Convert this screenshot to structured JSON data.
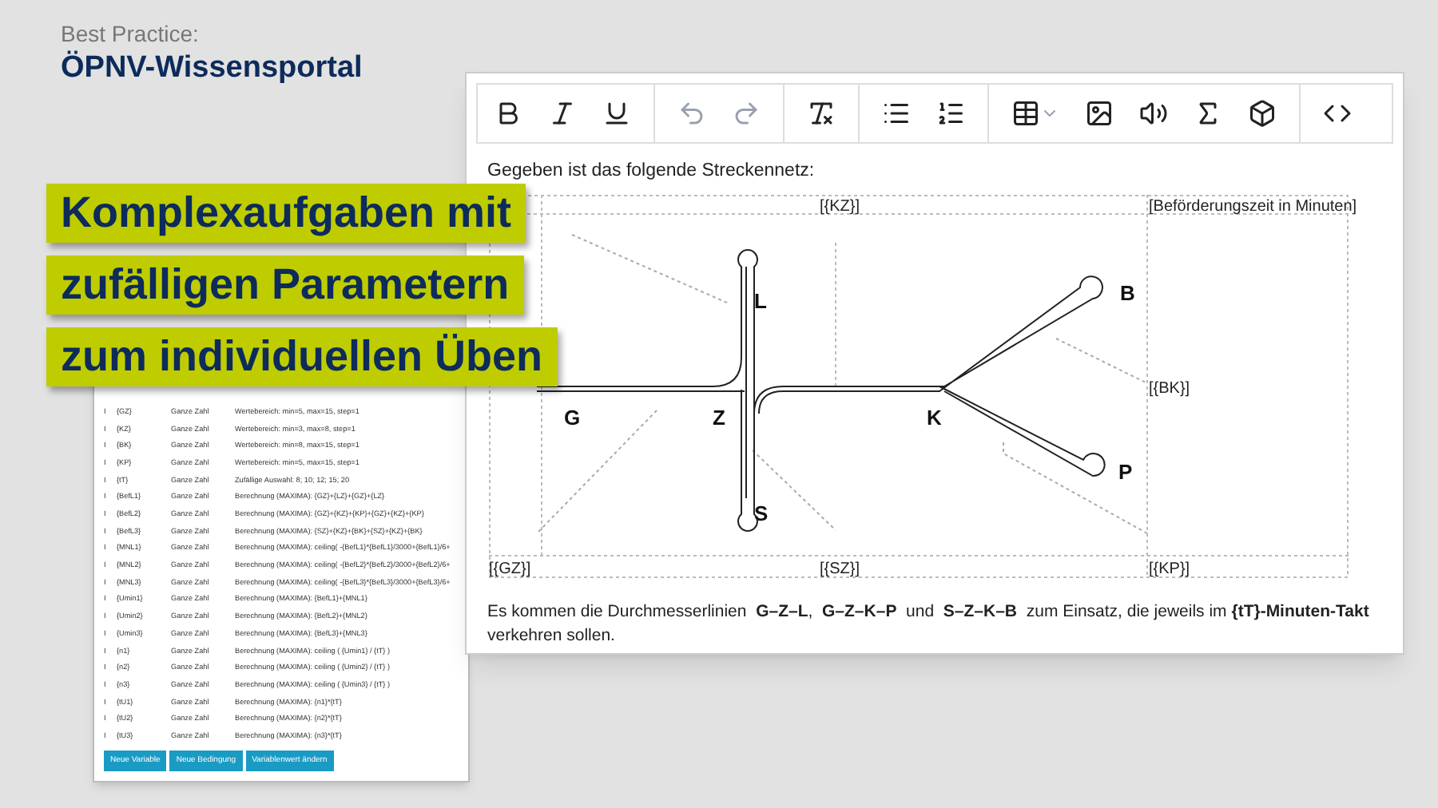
{
  "header": {
    "kicker": "Best Practice:",
    "title": "ÖPNV-Wissensportal"
  },
  "banners": [
    "Komplexaufgaben mit",
    "zufälligen Parametern",
    "zum individuellen Üben"
  ],
  "variables": {
    "rows": [
      {
        "marker": "I",
        "name": "{GZ}",
        "type": "Ganze Zahl",
        "definition": "Wertebereich: min=5, max=15, step=1"
      },
      {
        "marker": "I",
        "name": "{KZ}",
        "type": "Ganze Zahl",
        "definition": "Wertebereich: min=3, max=8, step=1"
      },
      {
        "marker": "I",
        "name": "{BK}",
        "type": "Ganze Zahl",
        "definition": "Wertebereich: min=8, max=15, step=1"
      },
      {
        "marker": "I",
        "name": "{KP}",
        "type": "Ganze Zahl",
        "definition": "Wertebereich: min=5, max=15, step=1"
      },
      {
        "marker": "I",
        "name": "{tT}",
        "type": "Ganze Zahl",
        "definition": "Zufällige Auswahl: 8; 10; 12; 15; 20"
      },
      {
        "marker": "I",
        "name": "{BefL1}",
        "type": "Ganze Zahl",
        "definition": "Berechnung (MAXIMA): {GZ}+{LZ}+{GZ}+{LZ}"
      },
      {
        "marker": "I",
        "name": "{BefL2}",
        "type": "Ganze Zahl",
        "definition": "Berechnung (MAXIMA): {GZ}+{KZ}+{KP}+{GZ}+{KZ}+{KP}"
      },
      {
        "marker": "I",
        "name": "{BefL3}",
        "type": "Ganze Zahl",
        "definition": "Berechnung (MAXIMA): {SZ}+{KZ}+{BK}+{SZ}+{KZ}+{BK}"
      },
      {
        "marker": "I",
        "name": "{MNL1}",
        "type": "Ganze Zahl",
        "definition": "Berechnung (MAXIMA): ceiling( -{BefL1}*{BefL1}/3000+{BefL1}/6+"
      },
      {
        "marker": "I",
        "name": "{MNL2}",
        "type": "Ganze Zahl",
        "definition": "Berechnung (MAXIMA): ceiling( -{BefL2}*{BefL2}/3000+{BefL2}/6+"
      },
      {
        "marker": "I",
        "name": "{MNL3}",
        "type": "Ganze Zahl",
        "definition": "Berechnung (MAXIMA): ceiling( -{BefL3}*{BefL3}/3000+{BefL3}/6+"
      },
      {
        "marker": "I",
        "name": "{Umin1}",
        "type": "Ganze Zahl",
        "definition": "Berechnung (MAXIMA): {BefL1}+{MNL1}"
      },
      {
        "marker": "I",
        "name": "{Umin2}",
        "type": "Ganze Zahl",
        "definition": "Berechnung (MAXIMA): {BefL2}+{MNL2}"
      },
      {
        "marker": "I",
        "name": "{Umin3}",
        "type": "Ganze Zahl",
        "definition": "Berechnung (MAXIMA): {BefL3}+{MNL3}"
      },
      {
        "marker": "I",
        "name": "{n1}",
        "type": "Ganze Zahl",
        "definition": "Berechnung (MAXIMA): ceiling ( {Umin1} / {tT} )"
      },
      {
        "marker": "I",
        "name": "{n2}",
        "type": "Ganze Zahl",
        "definition": "Berechnung (MAXIMA): ceiling ( {Umin2} / {tT} )"
      },
      {
        "marker": "I",
        "name": "{n3}",
        "type": "Ganze Zahl",
        "definition": "Berechnung (MAXIMA): ceiling ( {Umin3} / {tT} )"
      },
      {
        "marker": "I",
        "name": "{tU1}",
        "type": "Ganze Zahl",
        "definition": "Berechnung (MAXIMA): {n1}*{tT}"
      },
      {
        "marker": "I",
        "name": "{tU2}",
        "type": "Ganze Zahl",
        "definition": "Berechnung (MAXIMA): {n2}*{tT}"
      },
      {
        "marker": "I",
        "name": "{tU3}",
        "type": "Ganze Zahl",
        "definition": "Berechnung (MAXIMA): {n3}*{tT}"
      }
    ],
    "buttons": [
      "Neue Variable",
      "Neue Bedingung",
      "Variablenwert ändern"
    ]
  },
  "editor": {
    "intro": "Gegeben ist das folgende Streckennetz:",
    "diagram": {
      "placeholders": [
        "[{KZ}]",
        "[Beförderungszeit in Minuten]",
        "[{BK}]",
        "[{GZ}]",
        "[{SZ}]",
        "[{KP}]"
      ],
      "stations": [
        "G",
        "Z",
        "L",
        "S",
        "K",
        "B",
        "P"
      ]
    },
    "text": "Es kommen die Durchmesserlinien  **G–Z–L**,  **G–Z–K–P**  und  **S–Z–K–B**  zum Einsatz, die jeweils im **{tT}-Minuten-Takt** verkehren sollen."
  }
}
